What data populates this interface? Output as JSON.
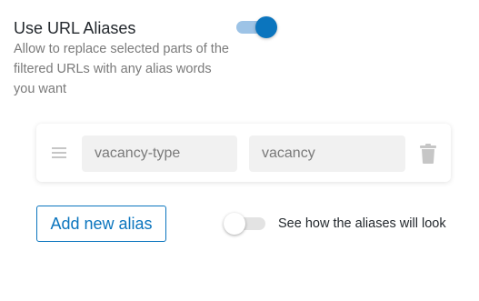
{
  "setting": {
    "title": "Use URL Aliases",
    "description": "Allow to replace selected parts of the filtered URLs with any alias words you want",
    "enabled": true
  },
  "aliases": [
    {
      "from_value": "vacancy-type",
      "to_value": "vacancy",
      "drag_icon": "drag-handle-icon",
      "delete_icon": "trash-icon"
    }
  ],
  "actions": {
    "add_label": "Add new alias",
    "preview_label": "See how the aliases will look",
    "preview_enabled": false
  },
  "colors": {
    "accent": "#0b75be",
    "accent_light": "#9dc3e6",
    "input_bg": "#f1f1f1",
    "muted_text": "#7a7a7a",
    "toggle_off_track": "#e3e3e3"
  }
}
